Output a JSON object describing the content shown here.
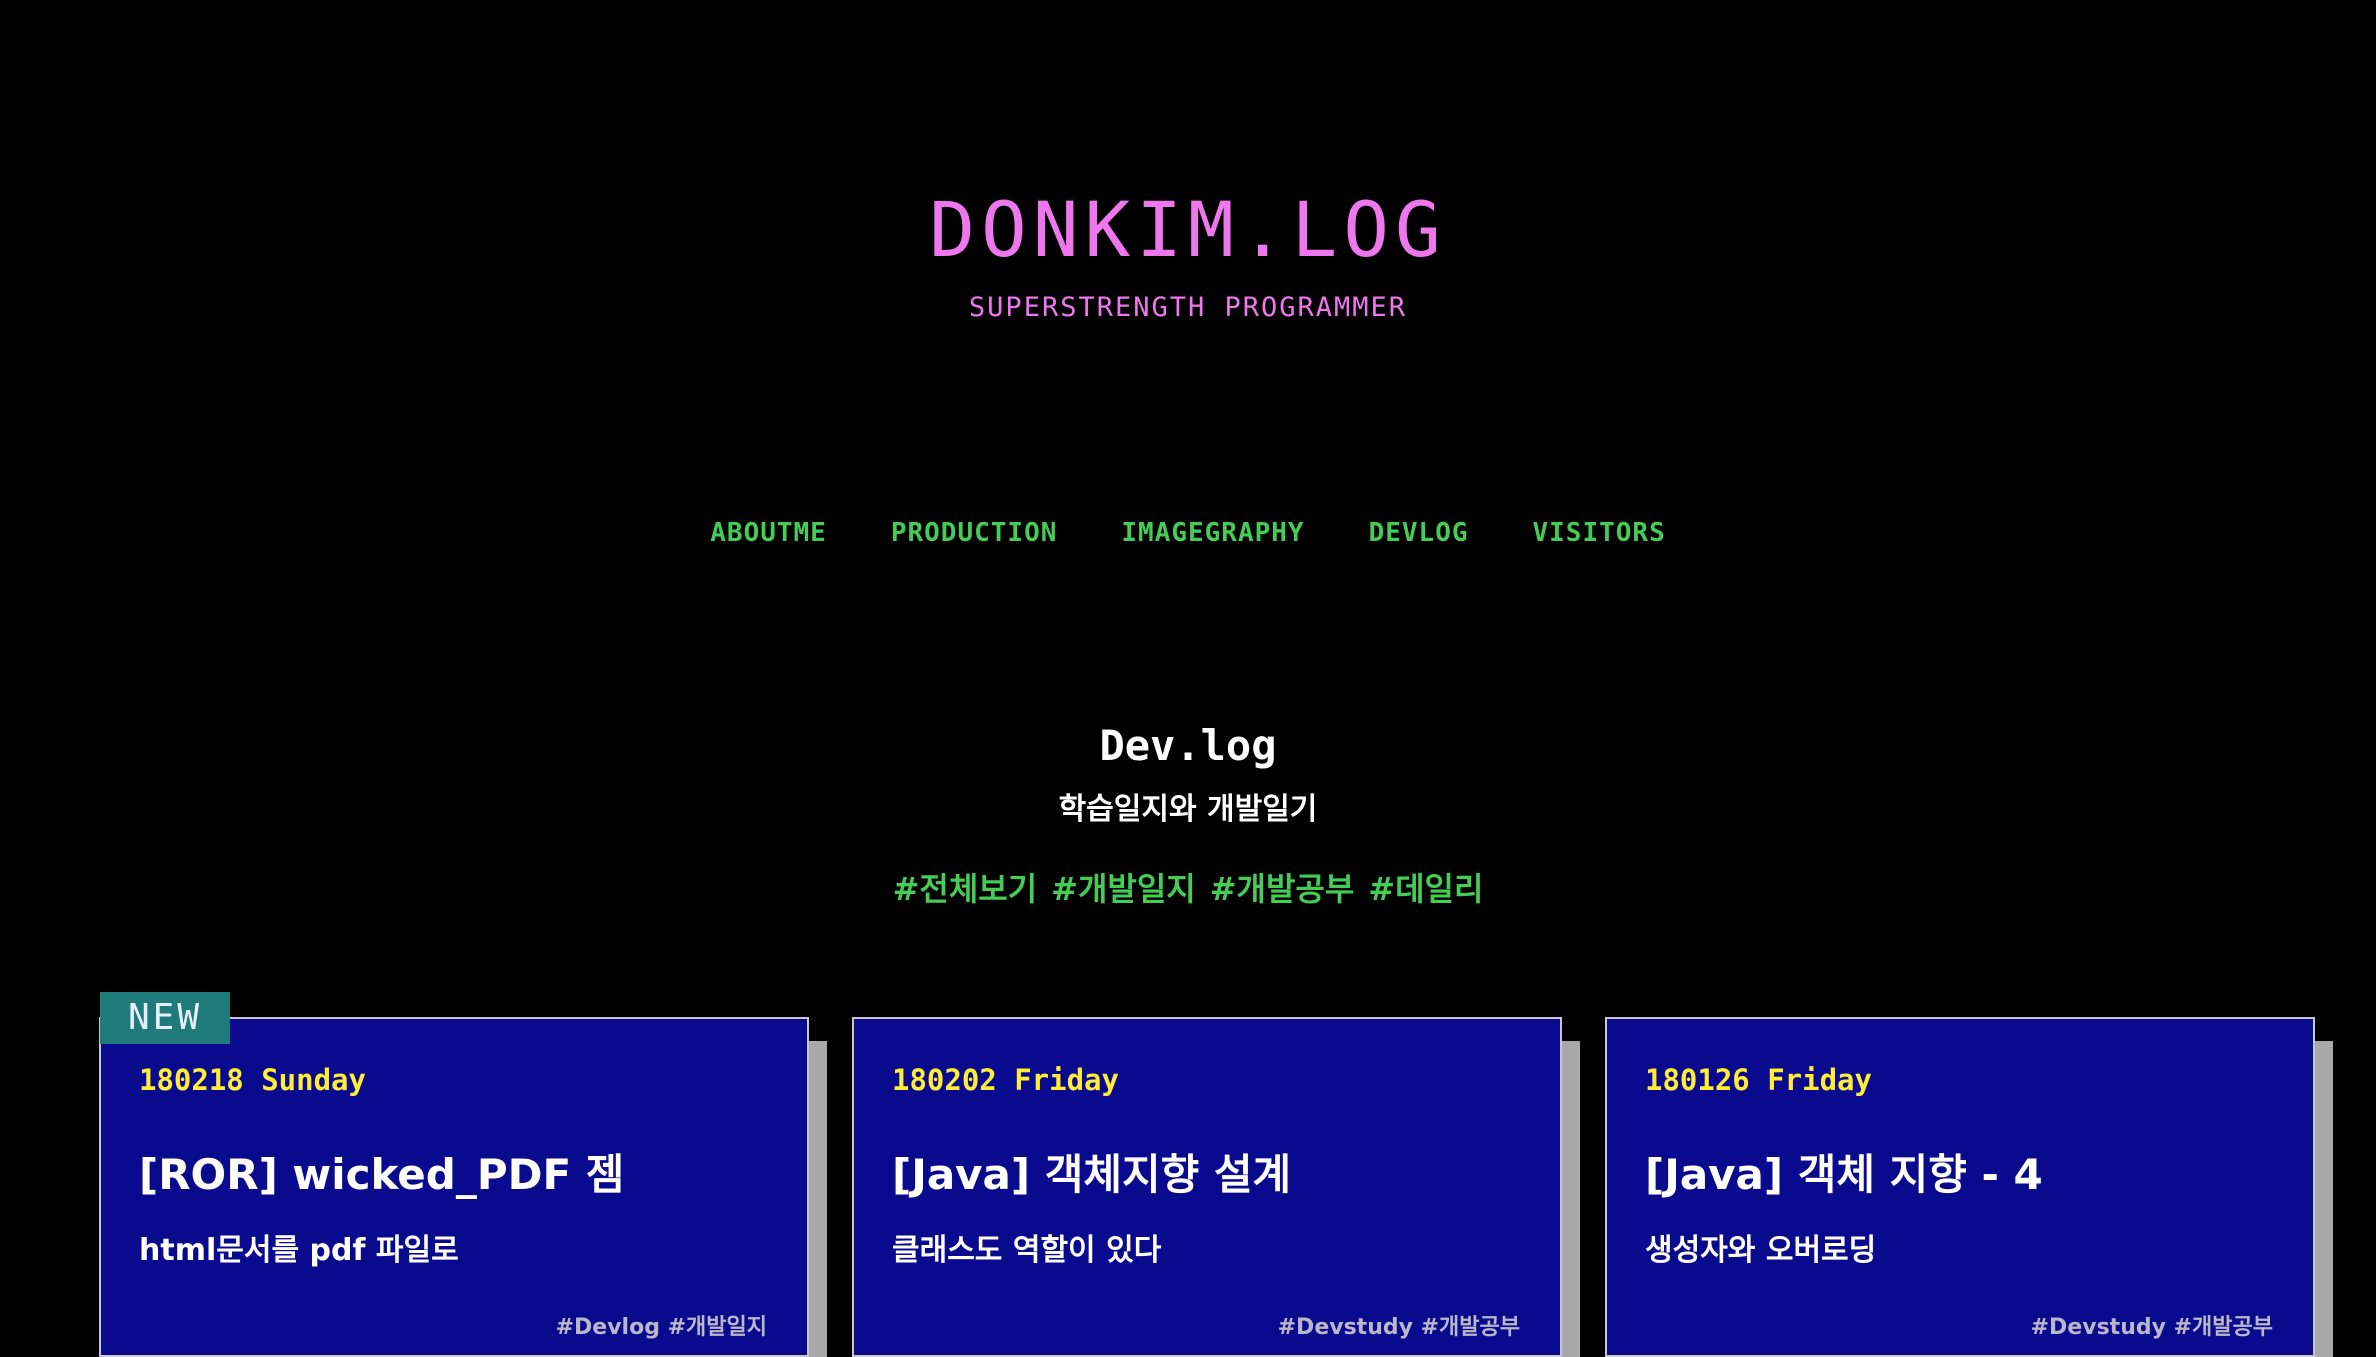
{
  "header": {
    "title": "DONKIM.LOG",
    "subtitle": "SUPERSTRENGTH PROGRAMMER"
  },
  "nav": {
    "items": [
      {
        "label": "ABOUTME"
      },
      {
        "label": "PRODUCTION"
      },
      {
        "label": "IMAGEGRAPHY"
      },
      {
        "label": "DEVLOG"
      },
      {
        "label": "VISITORS"
      }
    ]
  },
  "section": {
    "title": "Dev.log",
    "subtitle": "학습일지와 개발일기",
    "filters": [
      "#전체보기",
      "#개발일지",
      "#개발공부",
      "#데일리"
    ]
  },
  "badge": {
    "label": "NEW"
  },
  "posts": [
    {
      "date": "180218 Sunday",
      "title": "[ROR] wicked_PDF 젬",
      "description": "html문서를 pdf 파일로",
      "tags": "#Devlog #개발일지"
    },
    {
      "date": "180202 Friday",
      "title": "[Java] 객체지향 설계",
      "description": "클래스도 역할이 있다",
      "tags": "#Devstudy #개발공부"
    },
    {
      "date": "180126 Friday",
      "title": "[Java] 객체 지향 - 4",
      "description": "생성자와 오버로딩",
      "tags": "#Devstudy #개발공부"
    }
  ],
  "colors": {
    "background": "#000000",
    "title_pink": "#ee77ee",
    "nav_green": "#44cc55",
    "card_blue": "#0a0a8e",
    "date_yellow": "#ffee33",
    "badge_teal": "#1f7a7a"
  }
}
